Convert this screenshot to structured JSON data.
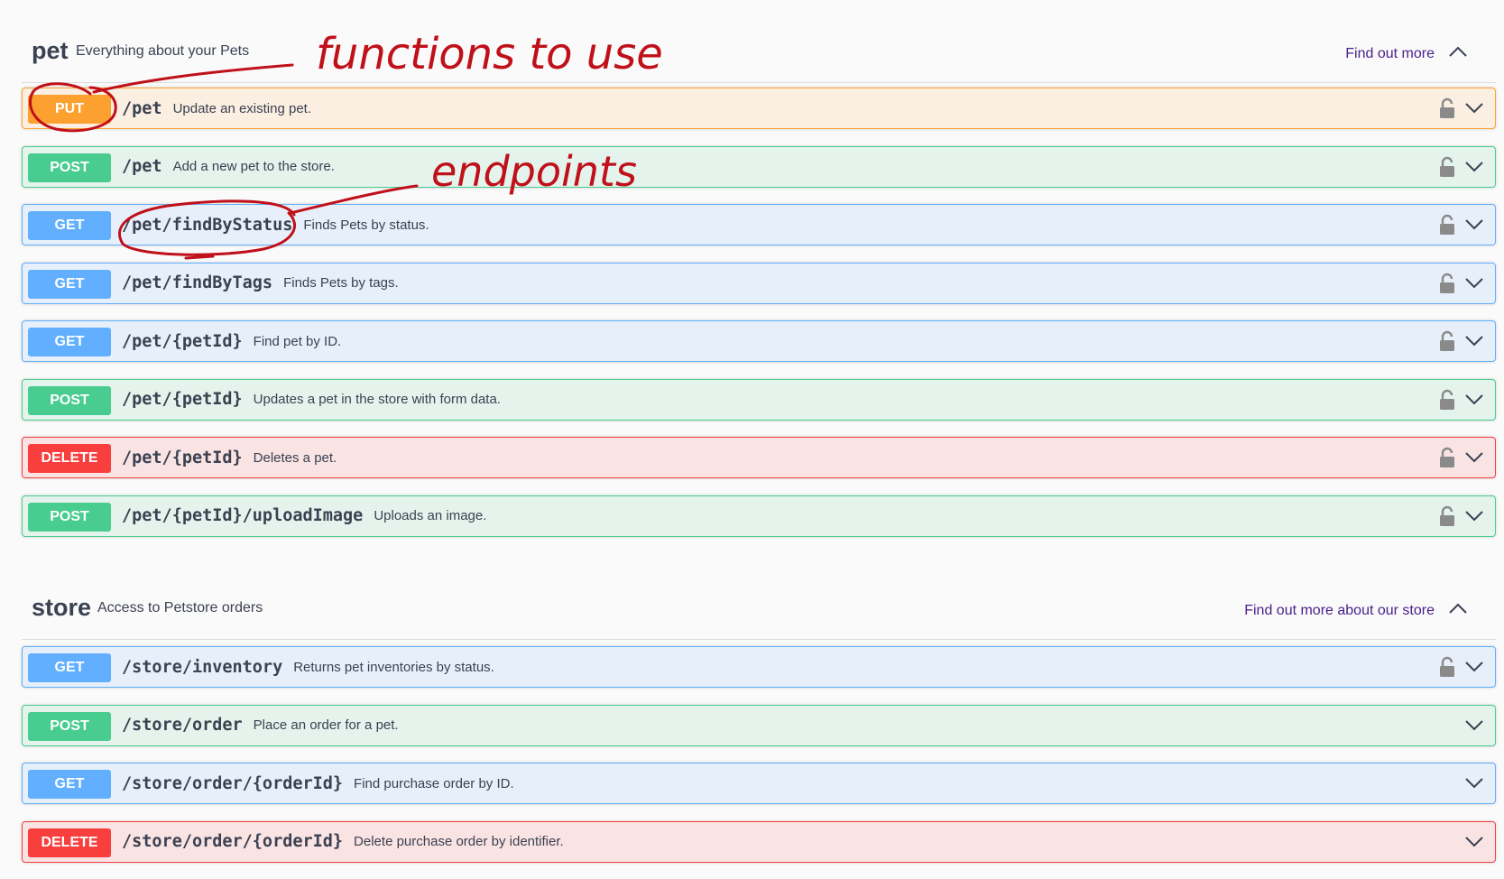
{
  "sections": [
    {
      "name": "pet",
      "description": "Everything about your Pets",
      "link": "Find out more",
      "operations": [
        {
          "method": "PUT",
          "path": "/pet",
          "summary": "Update an existing pet.",
          "locked": true
        },
        {
          "method": "POST",
          "path": "/pet",
          "summary": "Add a new pet to the store.",
          "locked": true
        },
        {
          "method": "GET",
          "path": "/pet/findByStatus",
          "summary": "Finds Pets by status.",
          "locked": true
        },
        {
          "method": "GET",
          "path": "/pet/findByTags",
          "summary": "Finds Pets by tags.",
          "locked": true
        },
        {
          "method": "GET",
          "path": "/pet/{petId}",
          "summary": "Find pet by ID.",
          "locked": true
        },
        {
          "method": "POST",
          "path": "/pet/{petId}",
          "summary": "Updates a pet in the store with form data.",
          "locked": true
        },
        {
          "method": "DELETE",
          "path": "/pet/{petId}",
          "summary": "Deletes a pet.",
          "locked": true
        },
        {
          "method": "POST",
          "path": "/pet/{petId}/uploadImage",
          "summary": "Uploads an image.",
          "locked": true
        }
      ]
    },
    {
      "name": "store",
      "description": "Access to Petstore orders",
      "link": "Find out more about our store",
      "operations": [
        {
          "method": "GET",
          "path": "/store/inventory",
          "summary": "Returns pet inventories by status.",
          "locked": true
        },
        {
          "method": "POST",
          "path": "/store/order",
          "summary": "Place an order for a pet.",
          "locked": false
        },
        {
          "method": "GET",
          "path": "/store/order/{orderId}",
          "summary": "Find purchase order by ID.",
          "locked": false
        },
        {
          "method": "DELETE",
          "path": "/store/order/{orderId}",
          "summary": "Delete purchase order by identifier.",
          "locked": false
        }
      ]
    }
  ],
  "annotations": {
    "functions_label": "functions to use",
    "endpoints_label": "endpoints",
    "ink_color": "#c0101a"
  },
  "colors": {
    "get": "#61affe",
    "post": "#49cc90",
    "put": "#fca130",
    "delete": "#f93e3e",
    "link": "#4a1f89"
  }
}
